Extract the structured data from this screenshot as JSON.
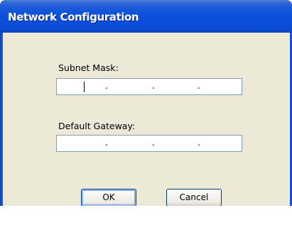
{
  "window": {
    "title": "Network Configuration"
  },
  "subnet_mask": {
    "label": "Subnet Mask:",
    "octets": [
      "",
      "",
      "",
      ""
    ],
    "separators": [
      ".",
      ".",
      "."
    ]
  },
  "default_gateway": {
    "label": "Default Gateway:",
    "octets": [
      "",
      "",
      "",
      ""
    ],
    "separators": [
      ".",
      ".",
      "."
    ]
  },
  "buttons": {
    "ok_label": "OK",
    "cancel_label": "Cancel"
  },
  "colors": {
    "titlebar": "#0a4ed9",
    "client_background": "#ece9d8",
    "input_border": "#7f9db9",
    "button_border": "#003c74"
  }
}
